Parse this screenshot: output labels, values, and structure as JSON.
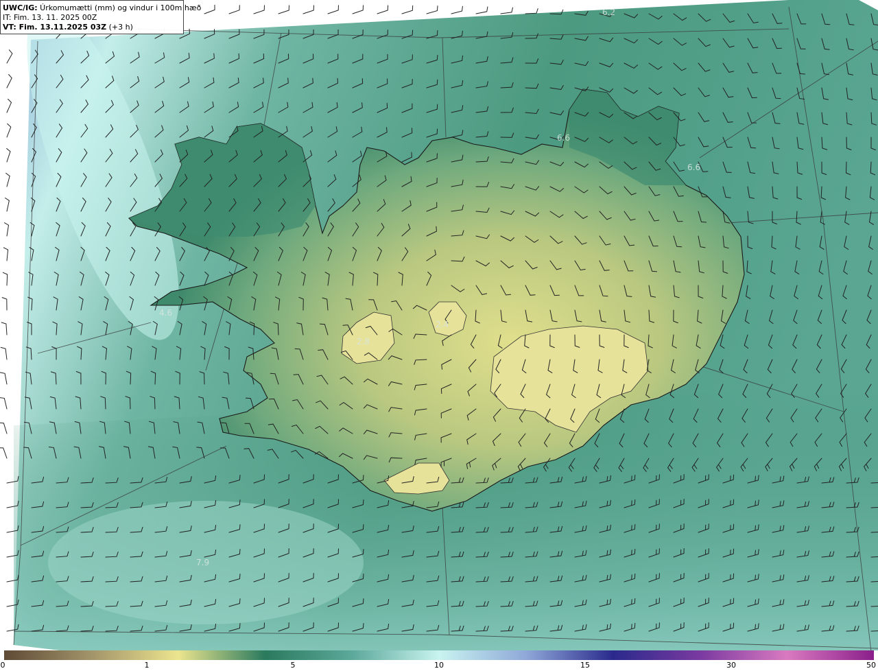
{
  "header": {
    "model_prefix": "UWC/IG:",
    "title": " Úrkomumætti (mm) og vindur i 100m hæð",
    "init_time": "IT: Fim. 13. 11. 2025 00Z",
    "valid_prefix": "VT: Fim. 13.11.2025 03Z",
    "valid_suffix": " (+3 h)"
  },
  "value_labels": [
    "6.2",
    "6.6",
    "6.6",
    "4.6",
    "2.8",
    "2.4",
    "7.9"
  ],
  "colorbar": {
    "ticks": [
      "0",
      "1",
      "5",
      "10",
      "15",
      "30",
      "50"
    ],
    "colors": [
      "#5f4a36",
      "#a2946a",
      "#ece58e",
      "#2a7a5e",
      "#5ca89a",
      "#c9f4f0",
      "#8fa8d8",
      "#2a2a8c",
      "#7a3aa0",
      "#d97ac0",
      "#8a1f8a"
    ]
  },
  "map_colors": {
    "ocean_light": "#bfe9e6",
    "ocean_mid": "#6fb6a8",
    "ocean_dark": "#3e8c76",
    "west_blue": "#8ab0d8",
    "land_low": "#4f9a7a",
    "land_high": "#e0e08a"
  }
}
